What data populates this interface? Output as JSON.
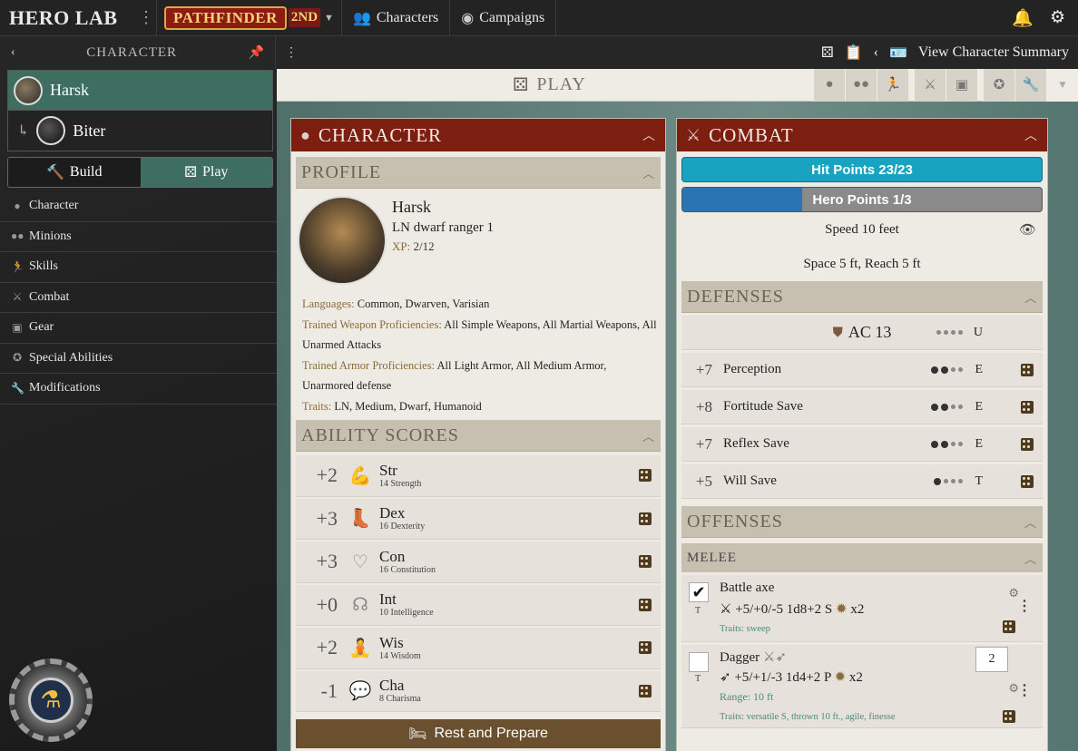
{
  "app": {
    "logo": "HERO LAB",
    "game": "PATHFINDER",
    "edition": "2ND"
  },
  "topnav": [
    {
      "icon": "users-icon",
      "label": "Characters"
    },
    {
      "icon": "globe-icon",
      "label": "Campaigns"
    }
  ],
  "sidebar": {
    "title": "CHARACTER",
    "character": {
      "name": "Harsk"
    },
    "minion": {
      "name": "Biter"
    },
    "modes": {
      "build": "Build",
      "play": "Play",
      "active": "Play"
    },
    "items": [
      {
        "icon": "person-icon",
        "label": "Character"
      },
      {
        "icon": "users-icon",
        "label": "Minions"
      },
      {
        "icon": "running-icon",
        "label": "Skills"
      },
      {
        "icon": "swords-icon",
        "label": "Combat"
      },
      {
        "icon": "backpack-icon",
        "label": "Gear"
      },
      {
        "icon": "medal-icon",
        "label": "Special Abilities"
      },
      {
        "icon": "wrench-icon",
        "label": "Modifications"
      }
    ]
  },
  "header": {
    "summary": "View Character Summary",
    "play_title": "PLAY"
  },
  "character_panel": {
    "title": "CHARACTER",
    "profile_heading": "PROFILE",
    "name": "Harsk",
    "class_line": "LN dwarf ranger 1",
    "xp_label": "XP:",
    "xp_value": "2/12",
    "languages_label": "Languages:",
    "languages": "Common, Dwarven, Varisian",
    "weapon_prof_label": "Trained Weapon Proficiencies:",
    "weapon_prof": "All Simple Weapons, All Martial Weapons, All Unarmed Attacks",
    "armor_prof_label": "Trained Armor Proficiencies:",
    "armor_prof": "All Light Armor, All Medium Armor, Unarmored defense",
    "traits_label": "Traits:",
    "traits": "LN, Medium, Dwarf, Humanoid",
    "abilities_heading": "ABILITY SCORES",
    "abilities": [
      {
        "mod": "+2",
        "short": "Str",
        "long": "14 Strength",
        "icon": "arm-icon"
      },
      {
        "mod": "+3",
        "short": "Dex",
        "long": "16 Dexterity",
        "icon": "boot-icon"
      },
      {
        "mod": "+3",
        "short": "Con",
        "long": "16 Constitution",
        "icon": "heart-body-icon"
      },
      {
        "mod": "+0",
        "short": "Int",
        "long": "10 Intelligence",
        "icon": "brain-icon"
      },
      {
        "mod": "+2",
        "short": "Wis",
        "long": "14 Wisdom",
        "icon": "meditate-icon"
      },
      {
        "mod": "-1",
        "short": "Cha",
        "long": "8 Charisma",
        "icon": "speech-icon"
      }
    ],
    "rest_button": "Rest and Prepare"
  },
  "combat_panel": {
    "title": "COMBAT",
    "hit_points": "Hit Points 23/23",
    "hero_points": "Hero Points 1/3",
    "hero_points_fraction": 0.333,
    "speed": "Speed 10 feet",
    "space": "Space 5 ft, Reach 5 ft",
    "defenses_heading": "DEFENSES",
    "ac": "AC 13",
    "ac_rank": "U",
    "saves": [
      {
        "mod": "+7",
        "name": "Perception",
        "rank": "E",
        "filled": 2
      },
      {
        "mod": "+8",
        "name": "Fortitude Save",
        "rank": "E",
        "filled": 2
      },
      {
        "mod": "+7",
        "name": "Reflex Save",
        "rank": "E",
        "filled": 2
      },
      {
        "mod": "+5",
        "name": "Will Save",
        "rank": "T",
        "filled": 1
      }
    ],
    "offenses_heading": "OFFENSES",
    "melee_heading": "MELEE",
    "weapons": [
      {
        "name": "Battle axe",
        "tag": "T",
        "stats": "+5/+0/-5  1d8+2 S",
        "crit": "x2",
        "traits": "Traits: sweep",
        "checked": true
      },
      {
        "name": "Dagger",
        "tag": "T",
        "stats": "+5/+1/-3  1d4+2 P",
        "crit": "x2",
        "range": "Range: 10 ft",
        "traits": "Traits: versatile S, thrown 10 ft., agile, finesse",
        "qty": "2",
        "checked": false
      }
    ]
  },
  "colors": {
    "accent_green": "#3d6e60",
    "panel_red": "#7c1e10",
    "hp_blue": "#18a3c0",
    "hero_blue": "#2a74b4",
    "rest_brown": "#6b5030"
  }
}
